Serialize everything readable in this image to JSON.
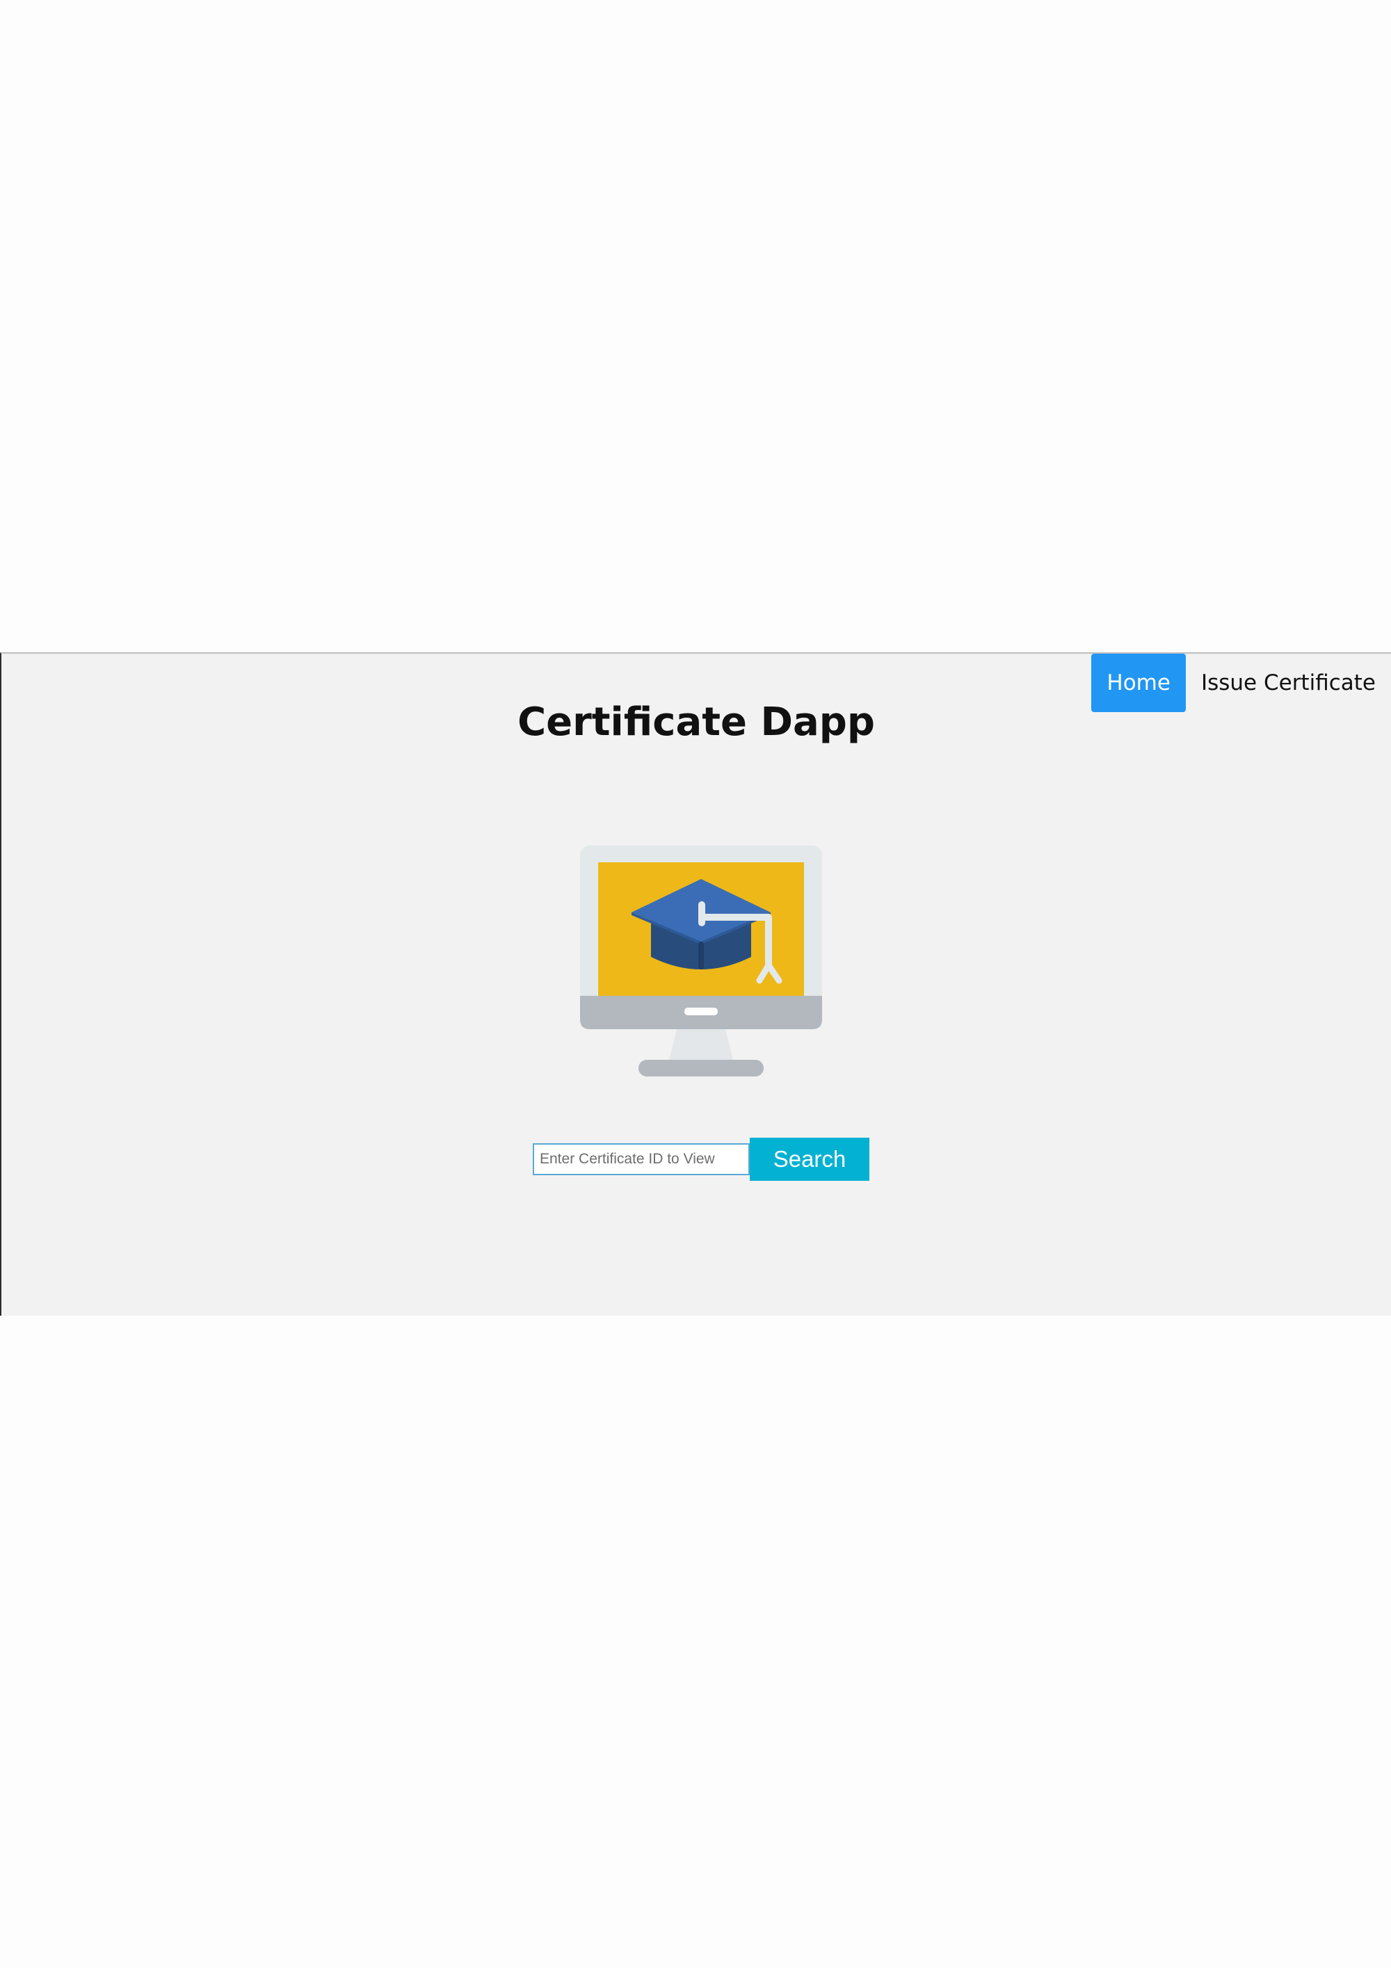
{
  "nav": {
    "items": [
      {
        "label": "Home",
        "active": true
      },
      {
        "label": "Issue Certificate",
        "active": false
      }
    ]
  },
  "header": {
    "title": "Certificate Dapp"
  },
  "hero": {
    "icon": "graduation-cap-monitor-icon"
  },
  "search": {
    "placeholder": "Enter Certificate ID to View",
    "value": "",
    "button_label": "Search"
  },
  "colors": {
    "app_background": "#f2f2f2",
    "nav_active": "#2196f3",
    "search_button": "#03b1d2",
    "screen_yellow": "#edb818",
    "cap_blue": "#3a6db5",
    "cap_dark": "#284d7d",
    "monitor_gray": "#b2b8be"
  }
}
